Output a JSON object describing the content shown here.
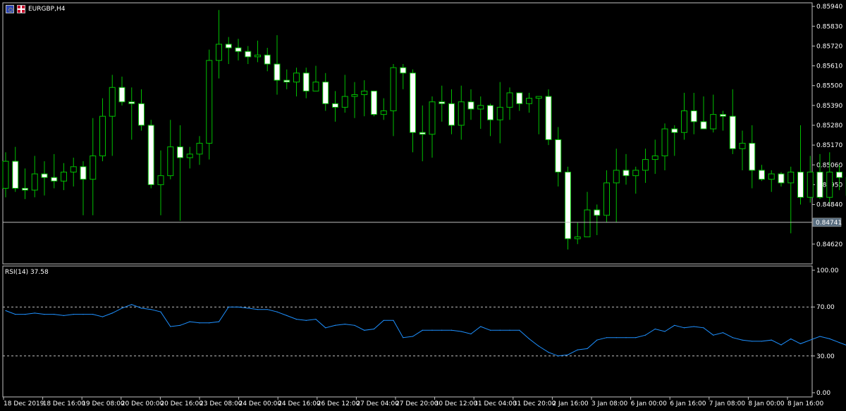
{
  "window": {
    "title": "EURGBP,H4",
    "indicator_label": "RSI(14) 37.58",
    "current_price_tag": "0.84741"
  },
  "colors": {
    "background": "#000000",
    "grid_frame": "#c0c0c0",
    "bull_candle_body": "#000000",
    "candle_outline": "#00c000",
    "bear_candle_body": "#ffffff",
    "rsi_line": "#1e90ff",
    "level_line": "#c0c0c0",
    "price_line": "#c0c0c0"
  },
  "chart_data": [
    {
      "type": "candlestick",
      "title": "EURGBP,H4",
      "y_tick_labels": [
        "0.85940",
        "0.85830",
        "0.85720",
        "0.85610",
        "0.85500",
        "0.85390",
        "0.85280",
        "0.85170",
        "0.85060",
        "0.84950",
        "0.84840",
        "0.84620"
      ],
      "y_ticks": [
        0.8594,
        0.8583,
        0.8572,
        0.8561,
        0.855,
        0.8539,
        0.8528,
        0.8517,
        0.8506,
        0.8495,
        0.8484,
        0.8462
      ],
      "ylim": [
        0.8451,
        0.8596
      ],
      "current_price": 0.84741,
      "x_tick_labels": [
        "18 Dec 2019",
        "18 Dec 16:00",
        "19 Dec 08:00",
        "20 Dec 00:00",
        "20 Dec 16:00",
        "23 Dec 08:00",
        "24 Dec 00:00",
        "24 Dec 16:00",
        "26 Dec 12:00",
        "27 Dec 04:00",
        "27 Dec 20:00",
        "30 Dec 12:00",
        "31 Dec 04:00",
        "31 Dec 20:00",
        "2 Jan 16:00",
        "3 Jan 08:00",
        "6 Jan 00:00",
        "6 Jan 16:00",
        "7 Jan 08:00",
        "8 Jan 00:00",
        "8 Jan 16:00"
      ],
      "candles": [
        {
          "o": 0.8493,
          "h": 0.8513,
          "l": 0.8488,
          "c": 0.8508
        },
        {
          "o": 0.8508,
          "h": 0.8516,
          "l": 0.8491,
          "c": 0.8493
        },
        {
          "o": 0.8493,
          "h": 0.8504,
          "l": 0.8487,
          "c": 0.8492
        },
        {
          "o": 0.8492,
          "h": 0.8511,
          "l": 0.8488,
          "c": 0.8501
        },
        {
          "o": 0.8501,
          "h": 0.8508,
          "l": 0.8489,
          "c": 0.8499
        },
        {
          "o": 0.8499,
          "h": 0.8512,
          "l": 0.8493,
          "c": 0.8497
        },
        {
          "o": 0.8497,
          "h": 0.8507,
          "l": 0.8492,
          "c": 0.8502
        },
        {
          "o": 0.8502,
          "h": 0.851,
          "l": 0.8494,
          "c": 0.8505
        },
        {
          "o": 0.8505,
          "h": 0.8508,
          "l": 0.8478,
          "c": 0.8498
        },
        {
          "o": 0.8498,
          "h": 0.8532,
          "l": 0.8478,
          "c": 0.8511
        },
        {
          "o": 0.8511,
          "h": 0.8543,
          "l": 0.8508,
          "c": 0.8533
        },
        {
          "o": 0.8533,
          "h": 0.8556,
          "l": 0.8511,
          "c": 0.8549
        },
        {
          "o": 0.8549,
          "h": 0.8555,
          "l": 0.8539,
          "c": 0.8541
        },
        {
          "o": 0.8541,
          "h": 0.8549,
          "l": 0.852,
          "c": 0.854
        },
        {
          "o": 0.854,
          "h": 0.8548,
          "l": 0.8525,
          "c": 0.8528
        },
        {
          "o": 0.8528,
          "h": 0.8531,
          "l": 0.8493,
          "c": 0.8495
        },
        {
          "o": 0.8495,
          "h": 0.8514,
          "l": 0.8478,
          "c": 0.85
        },
        {
          "o": 0.85,
          "h": 0.8531,
          "l": 0.8498,
          "c": 0.8516
        },
        {
          "o": 0.8516,
          "h": 0.8528,
          "l": 0.8475,
          "c": 0.851
        },
        {
          "o": 0.851,
          "h": 0.8516,
          "l": 0.8504,
          "c": 0.8512
        },
        {
          "o": 0.8512,
          "h": 0.8522,
          "l": 0.8506,
          "c": 0.8518
        },
        {
          "o": 0.8518,
          "h": 0.857,
          "l": 0.8509,
          "c": 0.8564
        },
        {
          "o": 0.8564,
          "h": 0.8592,
          "l": 0.8554,
          "c": 0.8573
        },
        {
          "o": 0.8573,
          "h": 0.8577,
          "l": 0.8562,
          "c": 0.8571
        },
        {
          "o": 0.8571,
          "h": 0.8576,
          "l": 0.8564,
          "c": 0.8569
        },
        {
          "o": 0.8569,
          "h": 0.8572,
          "l": 0.8562,
          "c": 0.8566
        },
        {
          "o": 0.8566,
          "h": 0.8575,
          "l": 0.8563,
          "c": 0.8567
        },
        {
          "o": 0.8567,
          "h": 0.8571,
          "l": 0.8558,
          "c": 0.8562
        },
        {
          "o": 0.8562,
          "h": 0.8578,
          "l": 0.8545,
          "c": 0.8553
        },
        {
          "o": 0.8553,
          "h": 0.8559,
          "l": 0.8548,
          "c": 0.8552
        },
        {
          "o": 0.8552,
          "h": 0.856,
          "l": 0.8544,
          "c": 0.8557
        },
        {
          "o": 0.8557,
          "h": 0.856,
          "l": 0.8543,
          "c": 0.8547
        },
        {
          "o": 0.8547,
          "h": 0.8561,
          "l": 0.8548,
          "c": 0.8552
        },
        {
          "o": 0.8552,
          "h": 0.8557,
          "l": 0.8536,
          "c": 0.854
        },
        {
          "o": 0.854,
          "h": 0.8547,
          "l": 0.853,
          "c": 0.8538
        },
        {
          "o": 0.8538,
          "h": 0.8556,
          "l": 0.8535,
          "c": 0.8544
        },
        {
          "o": 0.8544,
          "h": 0.8552,
          "l": 0.8532,
          "c": 0.8545
        },
        {
          "o": 0.8545,
          "h": 0.8553,
          "l": 0.8533,
          "c": 0.8547
        },
        {
          "o": 0.8547,
          "h": 0.8546,
          "l": 0.8533,
          "c": 0.8534
        },
        {
          "o": 0.8534,
          "h": 0.8543,
          "l": 0.8531,
          "c": 0.8536
        },
        {
          "o": 0.8536,
          "h": 0.8562,
          "l": 0.8522,
          "c": 0.856
        },
        {
          "o": 0.856,
          "h": 0.8562,
          "l": 0.8548,
          "c": 0.8557
        },
        {
          "o": 0.8557,
          "h": 0.8559,
          "l": 0.8513,
          "c": 0.8524
        },
        {
          "o": 0.8524,
          "h": 0.8539,
          "l": 0.8508,
          "c": 0.8523
        },
        {
          "o": 0.8523,
          "h": 0.8544,
          "l": 0.851,
          "c": 0.8541
        },
        {
          "o": 0.8541,
          "h": 0.855,
          "l": 0.853,
          "c": 0.854
        },
        {
          "o": 0.854,
          "h": 0.8548,
          "l": 0.8523,
          "c": 0.8528
        },
        {
          "o": 0.8528,
          "h": 0.855,
          "l": 0.852,
          "c": 0.8541
        },
        {
          "o": 0.8541,
          "h": 0.8548,
          "l": 0.8531,
          "c": 0.8537
        },
        {
          "o": 0.8537,
          "h": 0.8544,
          "l": 0.8526,
          "c": 0.8539
        },
        {
          "o": 0.8539,
          "h": 0.854,
          "l": 0.8522,
          "c": 0.8531
        },
        {
          "o": 0.8531,
          "h": 0.8552,
          "l": 0.8518,
          "c": 0.8538
        },
        {
          "o": 0.8538,
          "h": 0.8549,
          "l": 0.8531,
          "c": 0.8546
        },
        {
          "o": 0.8546,
          "h": 0.8544,
          "l": 0.8536,
          "c": 0.854
        },
        {
          "o": 0.854,
          "h": 0.8546,
          "l": 0.8535,
          "c": 0.8543
        },
        {
          "o": 0.8543,
          "h": 0.8544,
          "l": 0.8523,
          "c": 0.8544
        },
        {
          "o": 0.8544,
          "h": 0.8548,
          "l": 0.8517,
          "c": 0.852
        },
        {
          "o": 0.852,
          "h": 0.8527,
          "l": 0.8494,
          "c": 0.8502
        },
        {
          "o": 0.8502,
          "h": 0.8505,
          "l": 0.8459,
          "c": 0.8465
        },
        {
          "o": 0.8465,
          "h": 0.8474,
          "l": 0.8462,
          "c": 0.8466
        },
        {
          "o": 0.8466,
          "h": 0.8491,
          "l": 0.8475,
          "c": 0.8481
        },
        {
          "o": 0.8481,
          "h": 0.8484,
          "l": 0.8467,
          "c": 0.8478
        },
        {
          "o": 0.8478,
          "h": 0.8503,
          "l": 0.8474,
          "c": 0.8496
        },
        {
          "o": 0.8496,
          "h": 0.8515,
          "l": 0.8474,
          "c": 0.8503
        },
        {
          "o": 0.8503,
          "h": 0.8512,
          "l": 0.8495,
          "c": 0.85
        },
        {
          "o": 0.85,
          "h": 0.8505,
          "l": 0.849,
          "c": 0.8503
        },
        {
          "o": 0.8503,
          "h": 0.8515,
          "l": 0.8496,
          "c": 0.8509
        },
        {
          "o": 0.8509,
          "h": 0.852,
          "l": 0.8501,
          "c": 0.8511
        },
        {
          "o": 0.8511,
          "h": 0.8529,
          "l": 0.8503,
          "c": 0.8526
        },
        {
          "o": 0.8526,
          "h": 0.8528,
          "l": 0.8511,
          "c": 0.8524
        },
        {
          "o": 0.8524,
          "h": 0.8546,
          "l": 0.852,
          "c": 0.8536
        },
        {
          "o": 0.8536,
          "h": 0.8546,
          "l": 0.8523,
          "c": 0.853
        },
        {
          "o": 0.853,
          "h": 0.8544,
          "l": 0.8527,
          "c": 0.8526
        },
        {
          "o": 0.8526,
          "h": 0.8545,
          "l": 0.8524,
          "c": 0.8534
        },
        {
          "o": 0.8534,
          "h": 0.8536,
          "l": 0.8525,
          "c": 0.8533
        },
        {
          "o": 0.8533,
          "h": 0.8548,
          "l": 0.8512,
          "c": 0.8515
        },
        {
          "o": 0.8515,
          "h": 0.8525,
          "l": 0.8503,
          "c": 0.8518
        },
        {
          "o": 0.8518,
          "h": 0.8528,
          "l": 0.8493,
          "c": 0.8503
        },
        {
          "o": 0.8503,
          "h": 0.8506,
          "l": 0.8497,
          "c": 0.8498
        },
        {
          "o": 0.8498,
          "h": 0.8503,
          "l": 0.8491,
          "c": 0.8501
        },
        {
          "o": 0.8501,
          "h": 0.8502,
          "l": 0.8494,
          "c": 0.8496
        },
        {
          "o": 0.8496,
          "h": 0.8505,
          "l": 0.8468,
          "c": 0.8502
        },
        {
          "o": 0.8502,
          "h": 0.8528,
          "l": 0.8484,
          "c": 0.8488
        },
        {
          "o": 0.8488,
          "h": 0.8511,
          "l": 0.8485,
          "c": 0.8502
        },
        {
          "o": 0.8502,
          "h": 0.8512,
          "l": 0.8487,
          "c": 0.8488
        },
        {
          "o": 0.8488,
          "h": 0.8513,
          "l": 0.8485,
          "c": 0.8502
        },
        {
          "o": 0.8502,
          "h": 0.8506,
          "l": 0.8492,
          "c": 0.8499
        },
        {
          "o": 0.8499,
          "h": 0.8503,
          "l": 0.8464,
          "c": 0.8489
        },
        {
          "o": 0.8489,
          "h": 0.8504,
          "l": 0.8472,
          "c": 0.8475
        },
        {
          "o": 0.8475,
          "h": 0.8481,
          "l": 0.8467,
          "c": 0.8478
        }
      ]
    },
    {
      "type": "line",
      "title": "RSI(14) 37.58",
      "y_tick_labels": [
        "100.00",
        "70.00",
        "30.00",
        "0.00"
      ],
      "y_ticks": [
        100,
        70,
        30,
        0
      ],
      "levels": [
        70,
        30
      ],
      "ylim": [
        0,
        100
      ],
      "series": [
        {
          "values": [
            67,
            64,
            64,
            65,
            64,
            64,
            63,
            64,
            64,
            64,
            62,
            65,
            69,
            72,
            69,
            68,
            66,
            54,
            55,
            58,
            57,
            57,
            58,
            70,
            70,
            69,
            68,
            68,
            66,
            63,
            60,
            59,
            60,
            53,
            55,
            56,
            55,
            51,
            52,
            59,
            59,
            45,
            46,
            51,
            51,
            51,
            51,
            50,
            48,
            54,
            51,
            51,
            51,
            51,
            44,
            38,
            33,
            30,
            31,
            35,
            36,
            43,
            45,
            45,
            45,
            45,
            47,
            52,
            50,
            55,
            53,
            54,
            53,
            47,
            49,
            45,
            43,
            42,
            42,
            43,
            39,
            44,
            40,
            43,
            46,
            44,
            41,
            38,
            38
          ]
        }
      ]
    }
  ]
}
